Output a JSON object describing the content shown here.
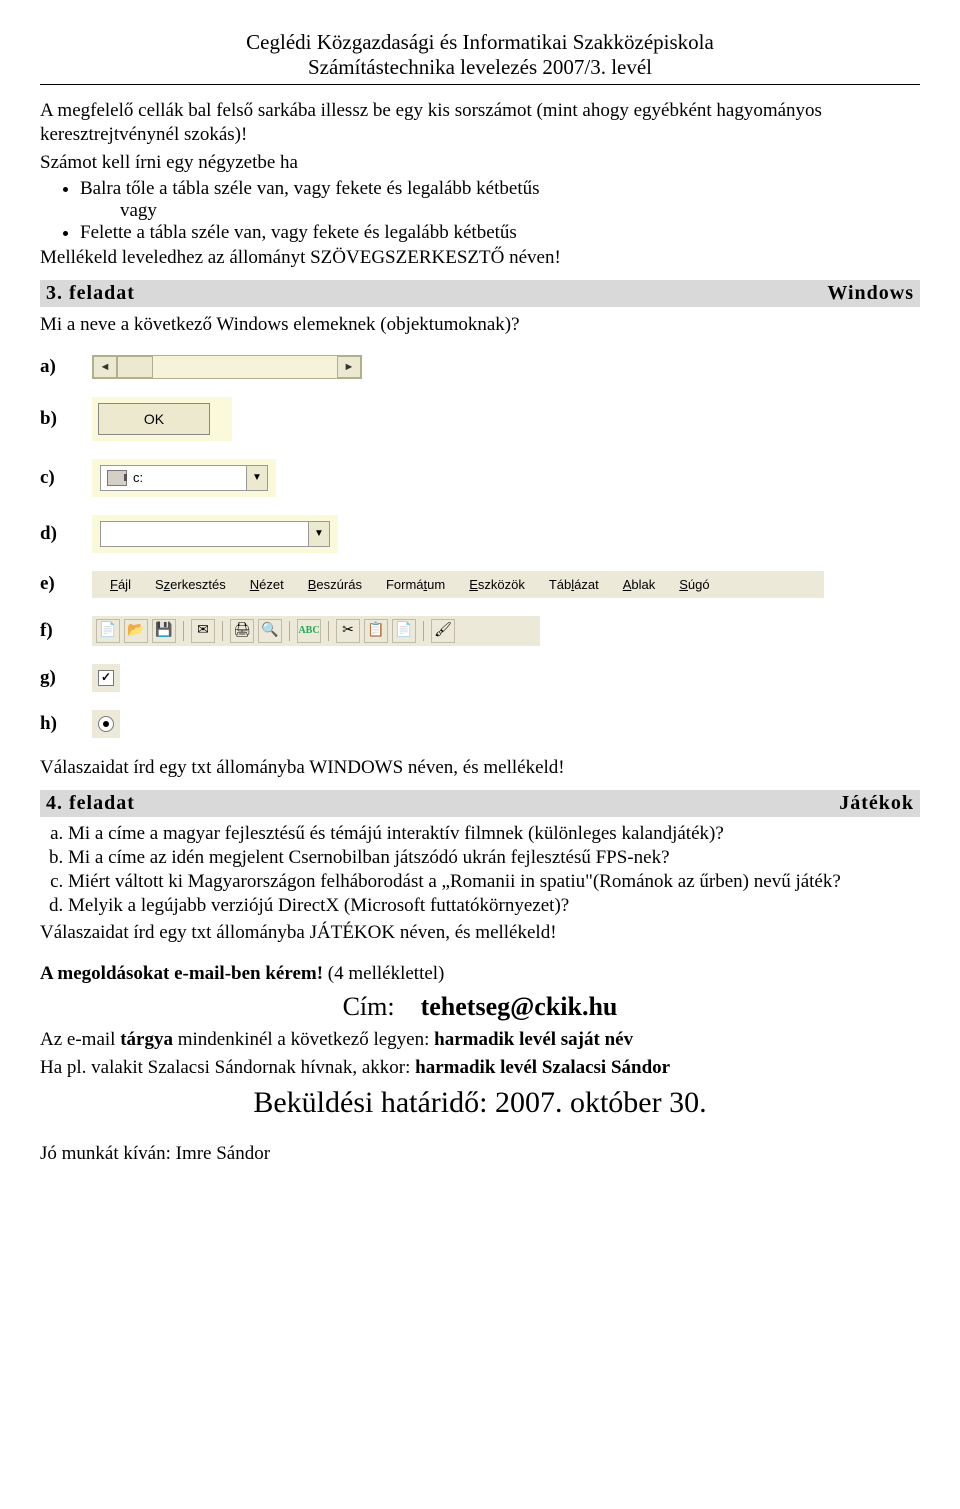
{
  "header": {
    "title": "Ceglédi Közgazdasági és Informatikai Szakközépiskola",
    "subtitle": "Számítástechnika levelezés 2007/3. levél"
  },
  "intro": {
    "p1": "A megfelelő cellák bal felső sarkába illessz be egy kis sorszámot (mint ahogy egyébként hagyományos keresztrejtvénynél szokás)!",
    "p2": "Számot kell írni egy négyzetbe ha",
    "b1": "Balra tőle a tábla széle van, vagy fekete és legalább kétbetűs",
    "b_or": "vagy",
    "b2": "Felette a tábla széle van, vagy fekete és legalább kétbetűs",
    "p3": "Mellékeld leveledhez az állományt SZÖVEGSZERKESZTŐ néven!"
  },
  "task3": {
    "left": "3. feladat",
    "right": "Windows",
    "question": "Mi a neve a következő Windows elemeknek (objektumoknak)?",
    "labels": {
      "a": "a)",
      "b": "b)",
      "c": "c)",
      "d": "d)",
      "e": "e)",
      "f": "f)",
      "g": "g)",
      "h": "h)"
    },
    "ok_label": "OK",
    "drive_text": "c:",
    "menus": {
      "fajl": "<u>F</u>ájl",
      "szerk": "S<u>z</u>erkesztés",
      "nezet": "<u>N</u>ézet",
      "beszur": "<u>B</u>eszúrás",
      "formatum": "Formá<u>t</u>um",
      "eszk": "<u>E</u>szközök",
      "tabl": "Táb<u>l</u>ázat",
      "ablak": "<u>A</u>blak",
      "sugo": "<u>S</u>úgó"
    },
    "after": "Válaszaidat írd egy txt állományba WINDOWS néven, és mellékeld!"
  },
  "task4": {
    "left": "4. feladat",
    "right": "Játékok",
    "qa": "Mi a címe a magyar fejlesztésű és témájú interaktív filmnek (különleges kalandjáték)?",
    "qb": "Mi a címe az idén megjelent Csernobilban játszódó ukrán fejlesztésű FPS-nek?",
    "qc": "Miért váltott ki Magyarországon felháborodást a „Romanii in spatiu\"(Románok az űrben) nevű játék?",
    "qd": "Melyik a legújabb verziójú DirectX (Microsoft futtatókörnyezet)?",
    "after": "Válaszaidat írd egy txt állományba JÁTÉKOK néven, és mellékeld!"
  },
  "footer": {
    "ask": "A megoldásokat e-mail-ben kérem!",
    "ask_suffix": " (4 melléklettel)",
    "cim_label": "Cím:",
    "email": "tehetseg@ckik.hu",
    "subj1a": "Az e-mail ",
    "subj1b": "tárgya",
    "subj1c": " mindenkinél a következő legyen: ",
    "subj1d": "harmadik levél saját név",
    "subj2a": "Ha pl. valakit Szalacsi Sándornak hívnak, akkor: ",
    "subj2b": "harmadik levél Szalacsi Sándor",
    "deadline": "Beküldési határidő: 2007. október 30.",
    "bye": "Jó munkát kíván: Imre Sándor"
  }
}
